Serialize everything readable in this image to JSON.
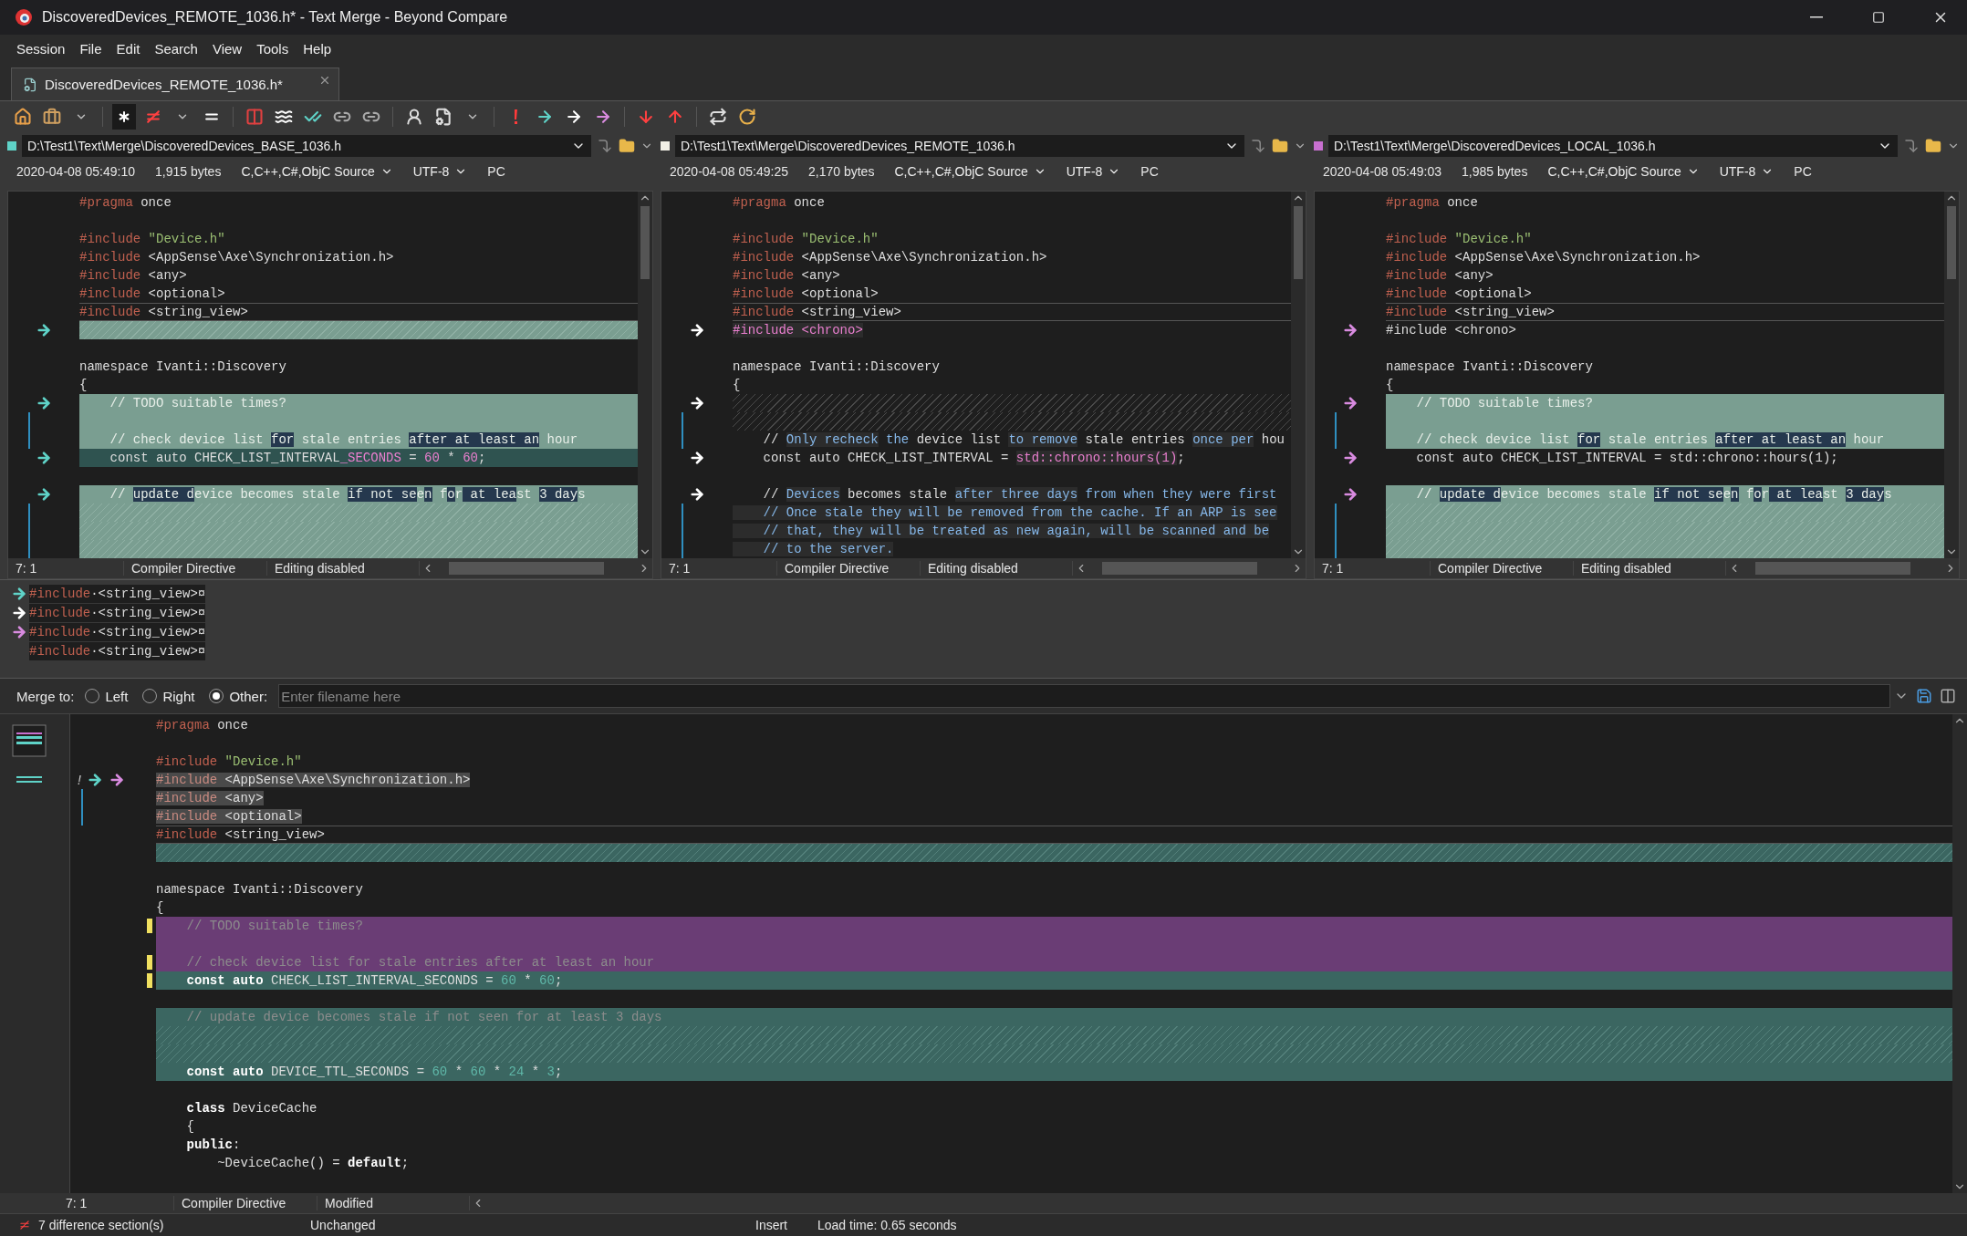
{
  "window": {
    "title": "DiscoveredDevices_REMOTE_1036.h* - Text Merge - Beyond Compare"
  },
  "menu": [
    "Session",
    "File",
    "Edit",
    "Search",
    "View",
    "Tools",
    "Help"
  ],
  "tabs": [
    {
      "label": "DiscoveredDevices_REMOTE_1036.h*",
      "selected": true
    }
  ],
  "files": [
    {
      "path": "D:\\Test1\\Text\\Merge\\DiscoveredDevices_BASE_1036.h",
      "color": "#5fd3c8",
      "date": "2020-04-08 05:49:10",
      "size": "1,915 bytes",
      "format": "C,C++,C#,ObjC Source",
      "encoding": "UTF-8",
      "line_end": "PC"
    },
    {
      "path": "D:\\Test1\\Text\\Merge\\DiscoveredDevices_REMOTE_1036.h",
      "color": "#f2f0e6",
      "date": "2020-04-08 05:49:25",
      "size": "2,170 bytes",
      "format": "C,C++,C#,ObjC Source",
      "encoding": "UTF-8",
      "line_end": "PC"
    },
    {
      "path": "D:\\Test1\\Text\\Merge\\DiscoveredDevices_LOCAL_1036.h",
      "color": "#c86fd0",
      "date": "2020-04-08 05:49:03",
      "size": "1,985 bytes",
      "format": "C,C++,C#,ObjC Source",
      "encoding": "UTF-8",
      "line_end": "PC"
    }
  ],
  "panes": [
    {
      "rows": [
        {
          "kind": "plain",
          "tokens": [
            {
              "t": "#pragma",
              "kind": "pp"
            },
            {
              "t": " once"
            }
          ]
        },
        {
          "kind": "plain"
        },
        {
          "kind": "plain",
          "tokens": [
            {
              "t": "#include",
              "kind": "pp"
            },
            {
              "t": " \"Device.h\"",
              "kind": "str"
            }
          ]
        },
        {
          "kind": "plain",
          "tokens": [
            {
              "t": "#include",
              "kind": "pp"
            },
            {
              "t": " <AppSense\\Axe\\Synchronization.h>"
            }
          ]
        },
        {
          "kind": "plain",
          "tokens": [
            {
              "t": "#include",
              "kind": "pp"
            },
            {
              "t": " <any>"
            }
          ]
        },
        {
          "kind": "plain",
          "tokens": [
            {
              "t": "#include",
              "kind": "pp"
            },
            {
              "t": " <optional>"
            }
          ]
        },
        {
          "kind": "plain",
          "current": true,
          "tokens": [
            {
              "t": "#include",
              "kind": "pp"
            },
            {
              "t": " <string_view>"
            }
          ]
        },
        {
          "kind": "gap",
          "arrow": {
            "color": "#5fd3c8"
          }
        },
        {
          "kind": "plain"
        },
        {
          "kind": "plain",
          "tokens": [
            {
              "t": "namespace Ivanti::Discovery"
            }
          ]
        },
        {
          "kind": "plain",
          "tokens": [
            {
              "t": "{"
            }
          ]
        },
        {
          "kind": "changed",
          "arrow": {
            "color": "#5fd3c8"
          },
          "tokens": [
            {
              "t": "    // TODO suitable times?"
            }
          ]
        },
        {
          "kind": "changed",
          "span": true
        },
        {
          "kind": "changed",
          "span": true,
          "tokens": [
            {
              "t": "    // check device list "
            },
            {
              "t": "for",
              "m": true
            },
            {
              "t": " stale entries "
            },
            {
              "t": "after at least an",
              "m": true
            },
            {
              "t": " hour"
            }
          ]
        },
        {
          "kind": "conflict",
          "arrow": {
            "color": "#5fd3c8"
          },
          "tokens": [
            {
              "t": "    const auto CHECK_LIST_INTERVAL"
            },
            {
              "t": "_SECONDS",
              "kind": "add"
            },
            {
              "t": " = "
            },
            {
              "t": "60",
              "kind": "add"
            },
            {
              "t": " * "
            },
            {
              "t": "60",
              "kind": "add"
            },
            {
              "t": ";"
            }
          ]
        },
        {
          "kind": "plain"
        },
        {
          "kind": "changed",
          "arrow": {
            "color": "#5fd3c8"
          },
          "tokens": [
            {
              "t": "    // "
            },
            {
              "t": "update d",
              "m": true
            },
            {
              "t": "evice becomes stale "
            },
            {
              "t": "if not se",
              "m": true
            },
            {
              "t": "e"
            },
            {
              "t": "n",
              "m": true
            },
            {
              "t": " f"
            },
            {
              "t": "o",
              "m": true
            },
            {
              "t": "r"
            },
            {
              "t": " at lea",
              "m": true
            },
            {
              "t": "st "
            },
            {
              "t": "3 day",
              "m": true
            },
            {
              "t": "s"
            }
          ]
        },
        {
          "kind": "gap",
          "span": true
        },
        {
          "kind": "gap",
          "span": true
        },
        {
          "kind": "gap",
          "span": true
        }
      ],
      "status": [
        "7: 1",
        "Compiler Directive",
        "Editing disabled"
      ]
    },
    {
      "rows": [
        {
          "kind": "plain",
          "tokens": [
            {
              "t": "#pragma",
              "kind": "pp"
            },
            {
              "t": " once"
            }
          ]
        },
        {
          "kind": "plain"
        },
        {
          "kind": "plain",
          "tokens": [
            {
              "t": "#include",
              "kind": "pp"
            },
            {
              "t": " \"Device.h\"",
              "kind": "str"
            }
          ]
        },
        {
          "kind": "plain",
          "tokens": [
            {
              "t": "#include",
              "kind": "pp"
            },
            {
              "t": " <AppSense\\Axe\\Synchronization.h>"
            }
          ]
        },
        {
          "kind": "plain",
          "tokens": [
            {
              "t": "#include",
              "kind": "pp"
            },
            {
              "t": " <any>"
            }
          ]
        },
        {
          "kind": "plain",
          "tokens": [
            {
              "t": "#include",
              "kind": "pp"
            },
            {
              "t": " <optional>"
            }
          ]
        },
        {
          "kind": "plain",
          "current": true,
          "tokens": [
            {
              "t": "#include",
              "kind": "pp"
            },
            {
              "t": " <string_view>"
            }
          ]
        },
        {
          "kind": "plain",
          "arrow": {
            "color": "#ffffff"
          },
          "tokens": [
            {
              "t": "#include <chrono>",
              "kind": "add",
              "m": true
            }
          ]
        },
        {
          "kind": "plain"
        },
        {
          "kind": "plain",
          "tokens": [
            {
              "t": "namespace Ivanti::Discovery"
            }
          ]
        },
        {
          "kind": "plain",
          "tokens": [
            {
              "t": "{"
            }
          ]
        },
        {
          "kind": "gapdark",
          "arrow": {
            "color": "#ffffff"
          }
        },
        {
          "kind": "gapdark",
          "span": true
        },
        {
          "kind": "plain",
          "span": true,
          "tokens": [
            {
              "t": "    // "
            },
            {
              "t": "Only recheck",
              "kind": "blue",
              "m": true
            },
            {
              "t": " the",
              "kind": "blue"
            },
            {
              "t": " device list "
            },
            {
              "t": "to remove",
              "kind": "blue",
              "m": true
            },
            {
              "t": " stale entries "
            },
            {
              "t": "once per",
              "kind": "blue",
              "m": true
            },
            {
              "t": " hou"
            }
          ]
        },
        {
          "kind": "plain",
          "arrow": {
            "color": "#ffffff"
          },
          "tokens": [
            {
              "t": "    const auto CHECK_LIST_INTERVAL = "
            },
            {
              "t": "std::chrono::hours(1)",
              "kind": "add",
              "m": true
            },
            {
              "t": ";"
            }
          ]
        },
        {
          "kind": "plain"
        },
        {
          "kind": "plain",
          "arrow": {
            "color": "#ffffff"
          },
          "tokens": [
            {
              "t": "    // "
            },
            {
              "t": "Devices",
              "kind": "blue",
              "m": true
            },
            {
              "t": " becomes stale "
            },
            {
              "t": "after three days",
              "kind": "blue",
              "m": true
            },
            {
              "t": " from when they were first",
              "kind": "blue"
            }
          ]
        },
        {
          "kind": "plain",
          "span": true,
          "tokens": [
            {
              "t": "    // Once stale they will be removed from the cache. If an ARP is see",
              "kind": "blue",
              "m": true
            }
          ]
        },
        {
          "kind": "plain",
          "span": true,
          "tokens": [
            {
              "t": "    // that, they will be treated as new again, will be scanned and be",
              "kind": "blue",
              "m": true
            }
          ]
        },
        {
          "kind": "plain",
          "span": true,
          "tokens": [
            {
              "t": "    // to the server.",
              "kind": "blue",
              "m": true
            }
          ]
        }
      ],
      "status": [
        "7: 1",
        "Compiler Directive",
        "Editing disabled"
      ]
    },
    {
      "rows": [
        {
          "kind": "plain",
          "tokens": [
            {
              "t": "#pragma",
              "kind": "pp"
            },
            {
              "t": " once"
            }
          ]
        },
        {
          "kind": "plain"
        },
        {
          "kind": "plain",
          "tokens": [
            {
              "t": "#include",
              "kind": "pp"
            },
            {
              "t": " \"Device.h\"",
              "kind": "str"
            }
          ]
        },
        {
          "kind": "plain",
          "tokens": [
            {
              "t": "#include",
              "kind": "pp"
            },
            {
              "t": " <AppSense\\Axe\\Synchronization.h>"
            }
          ]
        },
        {
          "kind": "plain",
          "tokens": [
            {
              "t": "#include",
              "kind": "pp"
            },
            {
              "t": " <any>"
            }
          ]
        },
        {
          "kind": "plain",
          "tokens": [
            {
              "t": "#include",
              "kind": "pp"
            },
            {
              "t": " <optional>"
            }
          ]
        },
        {
          "kind": "plain",
          "current": true,
          "tokens": [
            {
              "t": "#include",
              "kind": "pp"
            },
            {
              "t": " <string_view>"
            }
          ]
        },
        {
          "kind": "plain",
          "arrow": {
            "color": "#d98be0"
          },
          "tokens": [
            {
              "t": "#include <chrono>"
            }
          ]
        },
        {
          "kind": "plain"
        },
        {
          "kind": "plain",
          "tokens": [
            {
              "t": "namespace Ivanti::Discovery"
            }
          ]
        },
        {
          "kind": "plain",
          "tokens": [
            {
              "t": "{"
            }
          ]
        },
        {
          "kind": "changed",
          "arrow": {
            "color": "#d98be0"
          },
          "tokens": [
            {
              "t": "    // TODO suitable times?"
            }
          ]
        },
        {
          "kind": "changed",
          "span": true
        },
        {
          "kind": "changed",
          "span": true,
          "tokens": [
            {
              "t": "    // check device list "
            },
            {
              "t": "for",
              "m": true
            },
            {
              "t": " stale entries "
            },
            {
              "t": "after at least an",
              "m": true
            },
            {
              "t": " hour"
            }
          ]
        },
        {
          "kind": "plain",
          "arrow": {
            "color": "#d98be0"
          },
          "tokens": [
            {
              "t": "    const auto CHECK_LIST_INTERVAL = std::chrono::hours(1);"
            }
          ]
        },
        {
          "kind": "plain"
        },
        {
          "kind": "changed",
          "arrow": {
            "color": "#d98be0"
          },
          "tokens": [
            {
              "t": "    // "
            },
            {
              "t": "update d",
              "m": true
            },
            {
              "t": "evice becomes stale "
            },
            {
              "t": "if not se",
              "m": true
            },
            {
              "t": "e"
            },
            {
              "t": "n",
              "m": true
            },
            {
              "t": " f"
            },
            {
              "t": "o",
              "m": true
            },
            {
              "t": "r"
            },
            {
              "t": " at lea",
              "m": true
            },
            {
              "t": "st "
            },
            {
              "t": "3 day",
              "m": true
            },
            {
              "t": "s"
            }
          ]
        },
        {
          "kind": "gap",
          "span": true
        },
        {
          "kind": "gap",
          "span": true
        },
        {
          "kind": "gap",
          "span": true
        }
      ],
      "status": [
        "7: 1",
        "Compiler Directive",
        "Editing disabled"
      ]
    }
  ],
  "line_details": [
    {
      "arrow": {
        "color": "#5fd3c8"
      },
      "tokens": [
        {
          "t": "#include",
          "kind": "pp"
        },
        {
          "t": "·<string_view>¤"
        }
      ]
    },
    {
      "arrow": {
        "color": "#ffffff"
      },
      "tokens": [
        {
          "t": "#include",
          "kind": "pp"
        },
        {
          "t": "·<string_view>¤"
        }
      ]
    },
    {
      "arrow": {
        "color": "#d98be0"
      },
      "tokens": [
        {
          "t": "#include",
          "kind": "pp"
        },
        {
          "t": "·<string_view>¤"
        }
      ]
    },
    {
      "tokens": [
        {
          "t": "#include",
          "kind": "pp"
        },
        {
          "t": "·<string_view>¤"
        }
      ]
    }
  ],
  "merge_to": {
    "label": "Merge to:",
    "options": [
      {
        "label": "Left",
        "selected": false
      },
      {
        "label": "Right",
        "selected": false
      },
      {
        "label": "Other:",
        "selected": true
      }
    ],
    "placeholder": "Enter filename here"
  },
  "output": {
    "rows": [
      {
        "kind": "plain",
        "tokens": [
          {
            "t": "#pragma",
            "kind": "pp"
          },
          {
            "t": " once"
          }
        ]
      },
      {
        "kind": "plain"
      },
      {
        "kind": "plain",
        "tokens": [
          {
            "t": "#include",
            "kind": "pp"
          },
          {
            "t": " \"Device.h\"",
            "kind": "str"
          }
        ]
      },
      {
        "kind": "sel",
        "bang": "!",
        "arrows": [
          {
            "color": "#5fd3c8"
          },
          {
            "color": "#d98be0"
          }
        ],
        "tokens": [
          {
            "t": "#include",
            "kind": "dimpp"
          },
          {
            "t": " <AppSense\\Axe\\Synchronization.h>"
          }
        ]
      },
      {
        "kind": "sel",
        "span": true,
        "tokens": [
          {
            "t": "#include",
            "kind": "dimpp"
          },
          {
            "t": " <any>"
          }
        ]
      },
      {
        "kind": "sel",
        "span": true,
        "tokens": [
          {
            "t": "#include",
            "kind": "dimpp"
          },
          {
            "t": " <optional>"
          }
        ]
      },
      {
        "kind": "plain",
        "current": true,
        "tokens": [
          {
            "t": "#include",
            "kind": "pp"
          },
          {
            "t": " <string_view>"
          }
        ]
      },
      {
        "kind": "tealgap"
      },
      {
        "kind": "plain"
      },
      {
        "kind": "plain",
        "tokens": [
          {
            "t": "namespace Ivanti::Discovery"
          }
        ]
      },
      {
        "kind": "plain",
        "tokens": [
          {
            "t": "{"
          }
        ]
      },
      {
        "kind": "purple",
        "flag": true,
        "tokens": [
          {
            "t": "    // TODO suitable times?",
            "kind": "dim"
          }
        ]
      },
      {
        "kind": "purple"
      },
      {
        "kind": "purple",
        "flag": true,
        "tokens": [
          {
            "t": "    // check device list for stale entries after at least an hour",
            "kind": "dim"
          }
        ]
      },
      {
        "kind": "teal",
        "flag": true,
        "tokens": [
          {
            "t": "    const auto",
            "kind": "kw"
          },
          {
            "t": " CHECK_LIST_INTERVAL_SECONDS = "
          },
          {
            "t": "60",
            "kind": "num"
          },
          {
            "t": " * "
          },
          {
            "t": "60",
            "kind": "num"
          },
          {
            "t": ";"
          }
        ]
      },
      {
        "kind": "plain"
      },
      {
        "kind": "teal",
        "tokens": [
          {
            "t": "    // update device becomes stale if not seen for at least 3 days",
            "kind": "dim"
          }
        ]
      },
      {
        "kind": "tealgap"
      },
      {
        "kind": "tealgap"
      },
      {
        "kind": "teal",
        "tokens": [
          {
            "t": "    const auto",
            "kind": "kw"
          },
          {
            "t": " DEVICE_TTL_SECONDS = "
          },
          {
            "t": "60",
            "kind": "num"
          },
          {
            "t": " * "
          },
          {
            "t": "60",
            "kind": "num"
          },
          {
            "t": " * "
          },
          {
            "t": "24",
            "kind": "num"
          },
          {
            "t": " * "
          },
          {
            "t": "3",
            "kind": "num"
          },
          {
            "t": ";"
          }
        ]
      },
      {
        "kind": "plain"
      },
      {
        "kind": "plain",
        "tokens": [
          {
            "t": "    class",
            "kind": "kw"
          },
          {
            "t": " DeviceCache"
          }
        ]
      },
      {
        "kind": "plain",
        "tokens": [
          {
            "t": "    {"
          }
        ]
      },
      {
        "kind": "plain",
        "tokens": [
          {
            "t": "    public",
            "kind": "kw"
          },
          {
            "t": ":"
          }
        ]
      },
      {
        "kind": "plain",
        "tokens": [
          {
            "t": "        ~DeviceCache() = "
          },
          {
            "t": "default",
            "kind": "kw"
          },
          {
            "t": ";"
          }
        ]
      }
    ],
    "status": [
      "7: 1",
      "Compiler Directive",
      "Modified"
    ]
  },
  "status_bar": [
    "7 difference section(s)",
    "Unchanged",
    "Insert",
    "Load time: 0.65 seconds"
  ]
}
